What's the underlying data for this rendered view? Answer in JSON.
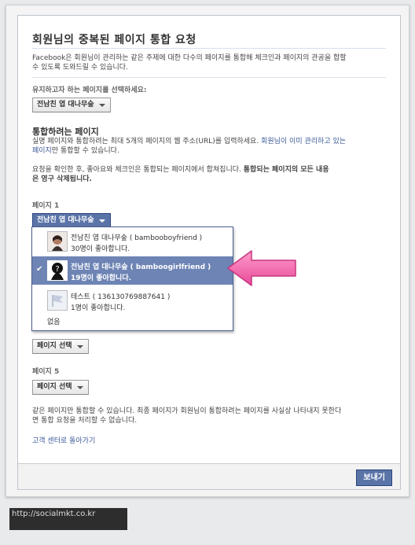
{
  "dialog": {
    "title": "회원님의 중복된 페이지 통합 요청",
    "intro_1": "Facebook은 회원님이 관리하는 같은 주제에 대한 다수의 페이지를 통합해 체크인과 페이지의 관공을 합할",
    "intro_2": "수 있도록 도와드릴 수 있습니다.",
    "keep_label": "유지하고자 하는 페이지를 선택하세요:",
    "keep_select": "전남친 엽 대나무숲",
    "merge_heading": "통합하려는 페이지",
    "merge_desc_1": "실명 페이지와 통합하려는 최대 5개의 페이지의 웹 주소(URL)를 입력하세요.",
    "merge_desc_link": "회원님이 이미 관리하고 있는",
    "merge_desc_2a": "페이지",
    "merge_desc_2b": "만 통합할 수 있습니다.",
    "warning_1a": "요청을 확인한 후, 좋아요와 체크인은 통합되는 페이지에서 합쳐집니다.",
    "warning_1b": "통합되는 페이지의 모든 내용",
    "warning_2": "은 영구 삭제됩니다.",
    "page1_label": "페이지 1",
    "page1_select": "전남친 엽 대나무숲",
    "page4_select": "페이지 선택",
    "page5_label": "페이지 5",
    "page5_select": "페이지 선택",
    "notice_1": "같은 페이지만 통합할 수 있습니다. 최종 페이지가 회원님이 통합하려는 페이지를 사실상 나타내지 못한다",
    "notice_2": "면 통합 요청을 처리할 수 없습니다.",
    "help_link": "고객 센터로 돌아가기",
    "submit": "보내기"
  },
  "menu": {
    "items": [
      {
        "line1": "전남친 엽 대나무숲 ( bambooboyfriend )",
        "line2": "30명이 좋아합니다."
      },
      {
        "line1": "전남친 엽 대나무숲 ( bamboogirlfriend )",
        "line2": "19명이 좋아합니다.",
        "selected": true
      },
      {
        "line1": "테스트 ( 136130769887641 )",
        "line2": "1명이 좋아합니다."
      }
    ],
    "none": "없음"
  },
  "watermark": "http://socialmkt.co.kr",
  "colors": {
    "facebook_blue": "#3b5998",
    "selected_row": "#6d84b4",
    "arrow_pink": "#f060a8"
  }
}
